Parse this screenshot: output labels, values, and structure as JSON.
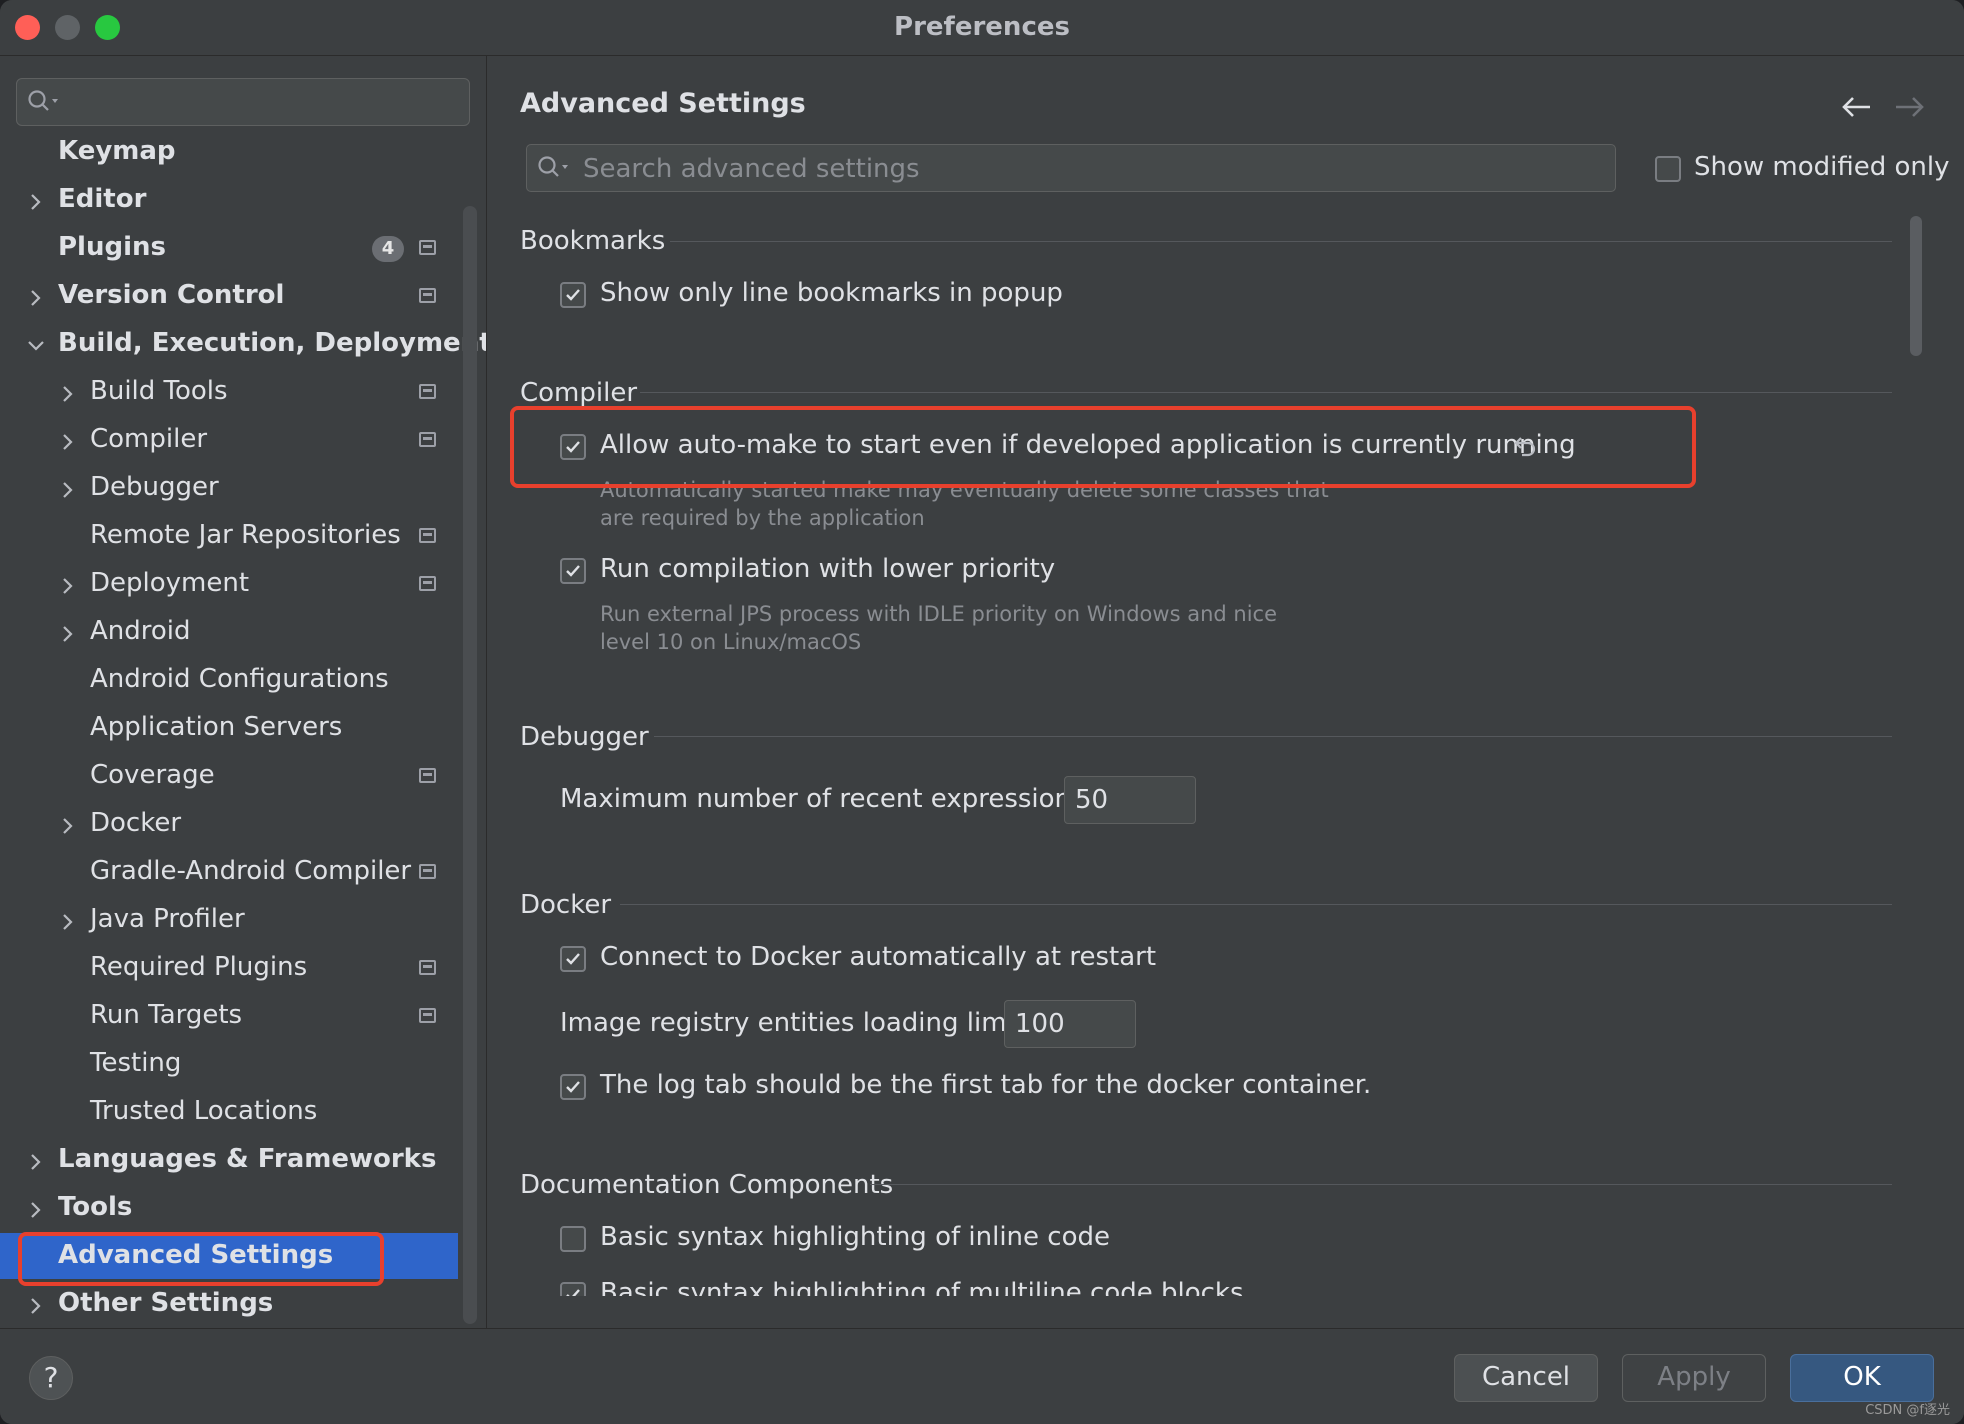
{
  "window": {
    "title": "Preferences"
  },
  "sidebar": {
    "items": [
      {
        "label": "Keymap",
        "bold": true,
        "level": 0,
        "chevron": "none"
      },
      {
        "label": "Editor",
        "bold": true,
        "level": 0,
        "chevron": "right"
      },
      {
        "label": "Plugins",
        "bold": true,
        "level": 0,
        "chevron": "none",
        "badge": "4",
        "project": true
      },
      {
        "label": "Version Control",
        "bold": true,
        "level": 0,
        "chevron": "right",
        "project": true
      },
      {
        "label": "Build, Execution, Deployment",
        "bold": true,
        "level": 0,
        "chevron": "down"
      },
      {
        "label": "Build Tools",
        "level": 1,
        "chevron": "right",
        "project": true
      },
      {
        "label": "Compiler",
        "level": 1,
        "chevron": "right",
        "project": true
      },
      {
        "label": "Debugger",
        "level": 1,
        "chevron": "right"
      },
      {
        "label": "Remote Jar Repositories",
        "level": 1,
        "chevron": "none",
        "project": true
      },
      {
        "label": "Deployment",
        "level": 1,
        "chevron": "right",
        "project": true
      },
      {
        "label": "Android",
        "level": 1,
        "chevron": "right"
      },
      {
        "label": "Android Configurations",
        "level": 1,
        "chevron": "none"
      },
      {
        "label": "Application Servers",
        "level": 1,
        "chevron": "none"
      },
      {
        "label": "Coverage",
        "level": 1,
        "chevron": "none",
        "project": true
      },
      {
        "label": "Docker",
        "level": 1,
        "chevron": "right"
      },
      {
        "label": "Gradle-Android Compiler",
        "level": 1,
        "chevron": "none",
        "project": true
      },
      {
        "label": "Java Profiler",
        "level": 1,
        "chevron": "right"
      },
      {
        "label": "Required Plugins",
        "level": 1,
        "chevron": "none",
        "project": true
      },
      {
        "label": "Run Targets",
        "level": 1,
        "chevron": "none",
        "project": true
      },
      {
        "label": "Testing",
        "level": 1,
        "chevron": "none"
      },
      {
        "label": "Trusted Locations",
        "level": 1,
        "chevron": "none"
      },
      {
        "label": "Languages & Frameworks",
        "bold": true,
        "level": 0,
        "chevron": "right"
      },
      {
        "label": "Tools",
        "bold": true,
        "level": 0,
        "chevron": "right"
      },
      {
        "label": "Advanced Settings",
        "bold": true,
        "level": 0,
        "chevron": "none",
        "selected": true
      },
      {
        "label": "Other Settings",
        "bold": true,
        "level": 0,
        "chevron": "right"
      }
    ]
  },
  "main": {
    "title": "Advanced Settings",
    "search_placeholder": "Search advanced settings",
    "show_modified_label": "Show modified only",
    "sections": {
      "bookmarks": {
        "title": "Bookmarks",
        "opt1": "Show only line bookmarks in popup"
      },
      "compiler": {
        "title": "Compiler",
        "opt1": "Allow auto-make to start even if developed application is currently running",
        "opt1_desc_1": "Automatically started make may eventually delete some classes that",
        "opt1_desc_2": "are required by the application",
        "opt2": "Run compilation with lower priority",
        "opt2_desc_1": "Run external JPS process with IDLE priority on Windows and nice",
        "opt2_desc_2": "level 10 on Linux/macOS"
      },
      "debugger": {
        "title": "Debugger",
        "max_expr_label": "Maximum number of recent expressions:",
        "max_expr_value": "50"
      },
      "docker": {
        "title": "Docker",
        "opt1": "Connect to Docker automatically at restart",
        "limit_label": "Image registry entities loading limit:",
        "limit_value": "100",
        "opt2": "The log tab should be the first tab for the docker container."
      },
      "docs": {
        "title": "Documentation Components",
        "opt1": "Basic syntax highlighting of inline code",
        "opt2": "Basic syntax highlighting of multiline code blocks"
      }
    }
  },
  "footer": {
    "help": "?",
    "cancel": "Cancel",
    "apply": "Apply",
    "ok": "OK",
    "watermark": "CSDN @f逐光"
  }
}
